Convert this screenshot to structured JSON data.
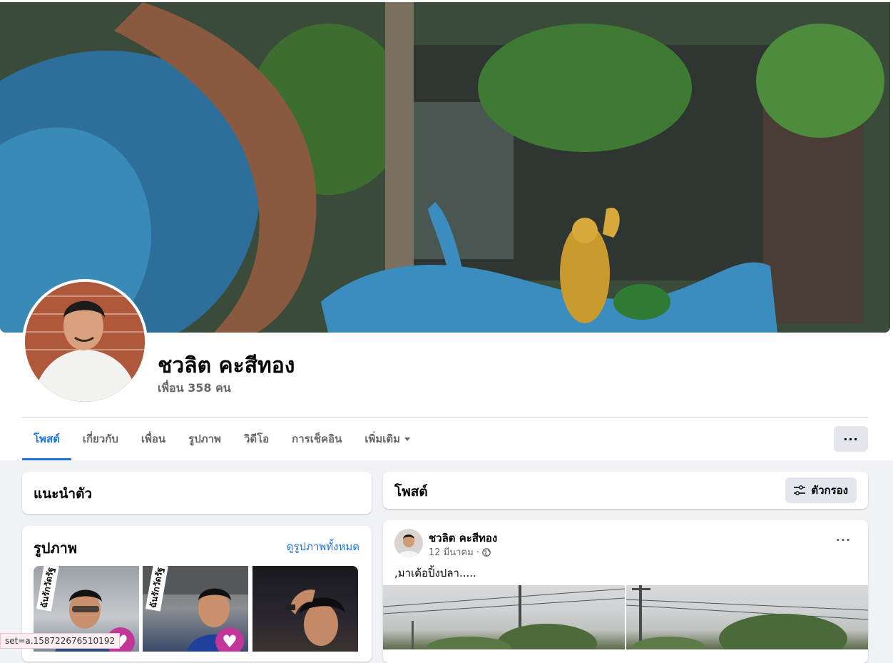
{
  "profile": {
    "name": "ชวลิต คะสีทอง",
    "friends": "เพื่อน 358 คน"
  },
  "tabs": [
    {
      "label": "โพสต์",
      "active": true
    },
    {
      "label": "เกี่ยวกับ"
    },
    {
      "label": "เพื่อน"
    },
    {
      "label": "รูปภาพ"
    },
    {
      "label": "วิดีโอ"
    },
    {
      "label": "การเช็คอิน"
    },
    {
      "label": "เพิ่มเติม"
    }
  ],
  "more_button": "···",
  "intro": {
    "title": "แนะนำตัว"
  },
  "photos": {
    "title": "รูปภาพ",
    "see_all": "ดูรูปภาพทั้งหมด",
    "overlay_text": "ฉันรักวัดรัฐ"
  },
  "posts_header": {
    "title": "โพสต์",
    "filter_label": "ตัวกรอง"
  },
  "post": {
    "author": "ชวลิต คะสีทอง",
    "date": "12 มีนาคม ·",
    "text": ",มาเด้อปิ้งปลา.....",
    "more": "···"
  },
  "status_bar": {
    "text": "set=a.158722676510192"
  },
  "colors": {
    "accent": "#1b74e4",
    "background": "#f0f2f5",
    "secondary_text": "#65676b"
  }
}
